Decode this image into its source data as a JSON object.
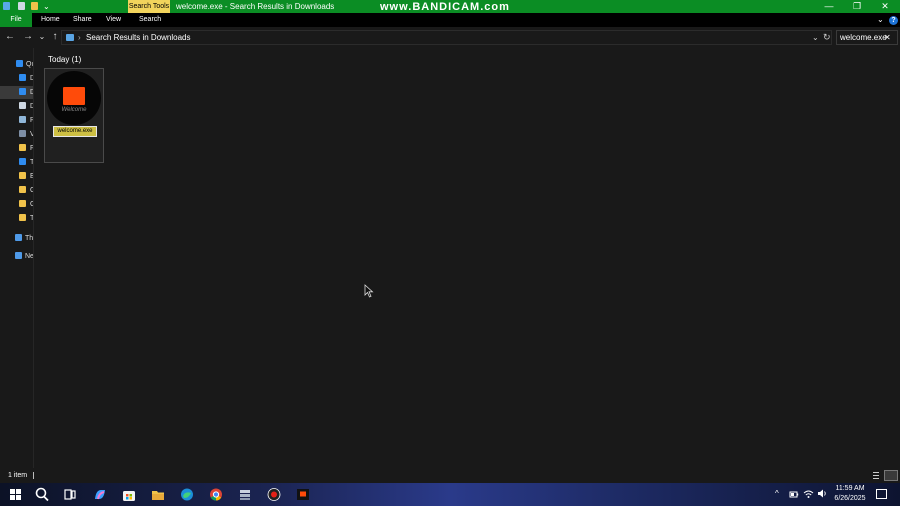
{
  "window": {
    "title": "welcome.exe - Search Results in Downloads",
    "context_tab": "Search Tools",
    "watermark": "www.BANDICAM.com",
    "minimize_glyph": "—",
    "maximize_glyph": "❐",
    "close_glyph": "✕"
  },
  "ribbon": {
    "tabs": [
      "File",
      "Home",
      "Share",
      "View",
      "Search"
    ],
    "expand_glyph": "⌄",
    "help_glyph": "?"
  },
  "address": {
    "back_glyph": "←",
    "forward_glyph": "→",
    "recent_glyph": "⌄",
    "up_glyph": "↑",
    "separator": "›",
    "path": "Search Results in Downloads",
    "dropdown_glyph": "⌄",
    "refresh_glyph": "↻"
  },
  "search": {
    "value": "welcome.exe",
    "clear_glyph": "✕"
  },
  "navpane": {
    "items": [
      {
        "label": "Qu",
        "icon": "star-icon",
        "color": "#2f8cf0"
      },
      {
        "label": "D",
        "icon": "desktop-icon",
        "color": "#2f8cf0"
      },
      {
        "label": "D",
        "icon": "downloads-icon",
        "color": "#2f8cf0"
      },
      {
        "label": "D",
        "icon": "documents-icon",
        "color": "#cfd8e3"
      },
      {
        "label": "P",
        "icon": "pictures-icon",
        "color": "#8fb6d8"
      },
      {
        "label": "V",
        "icon": "videos-icon",
        "color": "#7e8fa6"
      },
      {
        "label": "F",
        "icon": "folder-icon",
        "color": "#f0c24a"
      },
      {
        "label": "T",
        "icon": "music-icon",
        "color": "#2f8cf0"
      },
      {
        "label": "E",
        "icon": "folder-icon",
        "color": "#f0c24a"
      },
      {
        "label": "G",
        "icon": "folder-icon",
        "color": "#f0c24a"
      },
      {
        "label": "G",
        "icon": "folder-icon",
        "color": "#f0c24a"
      },
      {
        "label": "T",
        "icon": "folder-icon",
        "color": "#f0c24a"
      },
      {
        "label": "Th",
        "icon": "this-pc-icon",
        "color": "#4f9ae8"
      },
      {
        "label": "Ne",
        "icon": "network-icon",
        "color": "#4f9ae8"
      }
    ]
  },
  "content": {
    "group_header": "Today (1)",
    "file": {
      "name": "welcome.exe",
      "thumb_text": "Welcome",
      "accent": "#ff4b0a"
    }
  },
  "status": {
    "count": "1 item"
  },
  "taskbar": {
    "apps": [
      {
        "name": "start-icon",
        "active": false
      },
      {
        "name": "search-icon",
        "active": false
      },
      {
        "name": "task-view-icon",
        "active": false
      },
      {
        "name": "copilot-icon",
        "active": false
      },
      {
        "name": "store-icon",
        "active": false
      },
      {
        "name": "file-explorer-icon",
        "active": true
      },
      {
        "name": "edge-icon",
        "active": false
      },
      {
        "name": "chrome-icon",
        "active": false
      },
      {
        "name": "storage-app-icon",
        "active": true
      },
      {
        "name": "bandicam-icon",
        "active": true
      },
      {
        "name": "welcome-app-icon",
        "active": true
      }
    ],
    "tray": {
      "chevron_glyph": "^",
      "time": "11:59 AM",
      "date": "6/26/2025"
    }
  }
}
